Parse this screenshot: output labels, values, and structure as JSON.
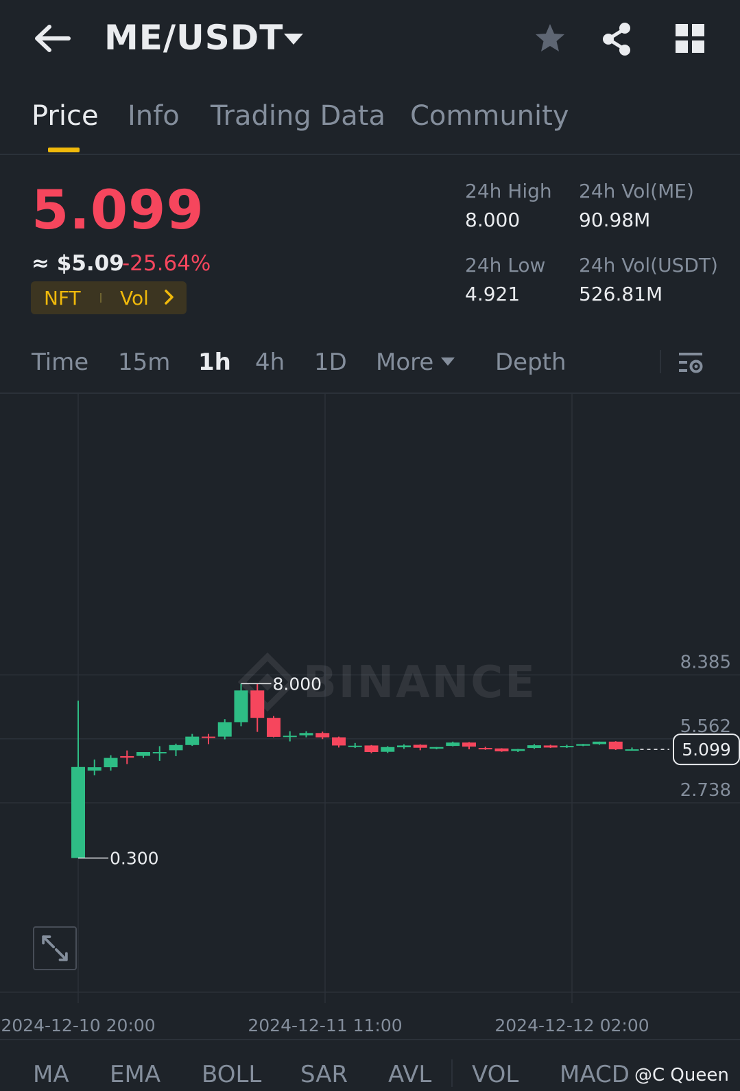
{
  "header": {
    "pair": "ME/USDT",
    "icons": [
      "back-arrow-icon",
      "caret-down-icon",
      "star-icon",
      "share-icon",
      "grid-icon"
    ]
  },
  "tabs": [
    {
      "label": "Price",
      "active": true
    },
    {
      "label": "Info",
      "active": false
    },
    {
      "label": "Trading Data",
      "active": false
    },
    {
      "label": "Community",
      "active": false
    }
  ],
  "price": {
    "last": "5.099",
    "usd": "≈ $5.09",
    "change": "-25.64%",
    "tag_nft": "NFT",
    "tag_vol": "Vol"
  },
  "stats": {
    "high_label": "24h High",
    "high_value": "8.000",
    "low_label": "24h Low",
    "low_value": "4.921",
    "vol_me_label": "24h Vol(ME)",
    "vol_me_value": "90.98M",
    "vol_usdt_label": "24h Vol(USDT)",
    "vol_usdt_value": "526.81M"
  },
  "intervals": {
    "time": "Time",
    "i15m": "15m",
    "i1h": "1h",
    "i4h": "4h",
    "i1d": "1D",
    "more": "More",
    "depth": "Depth",
    "active": "1h"
  },
  "chart_data": {
    "type": "candlestick",
    "watermark": "BINANCE",
    "y_ticks": [
      "8.385",
      "5.562",
      "2.738"
    ],
    "y_tick_values": [
      8.385,
      5.562,
      2.738
    ],
    "x_ticks": [
      "2024-12-10 20:00",
      "2024-12-11 11:00",
      "2024-12-12 02:00"
    ],
    "high_label": "8.000",
    "low_label": "0.300",
    "last_price_label": "5.099",
    "colors": {
      "up": "#2ebd85",
      "down": "#f6465d",
      "grid": "#2b3139",
      "axis_text": "#848e9c"
    },
    "candles": [
      {
        "o": 0.3,
        "h": 7.25,
        "l": 0.3,
        "c": 4.32
      },
      {
        "o": 4.16,
        "h": 4.65,
        "l": 3.95,
        "c": 4.31
      },
      {
        "o": 4.31,
        "h": 4.84,
        "l": 4.16,
        "c": 4.72
      },
      {
        "o": 4.8,
        "h": 5.05,
        "l": 4.45,
        "c": 4.73
      },
      {
        "o": 4.81,
        "h": 4.85,
        "l": 4.72,
        "c": 4.98
      },
      {
        "o": 4.92,
        "h": 5.24,
        "l": 4.59,
        "c": 4.98
      },
      {
        "o": 5.06,
        "h": 5.35,
        "l": 4.8,
        "c": 5.29
      },
      {
        "o": 5.29,
        "h": 5.78,
        "l": 5.25,
        "c": 5.66
      },
      {
        "o": 5.66,
        "h": 5.78,
        "l": 5.33,
        "c": 5.65
      },
      {
        "o": 5.66,
        "h": 6.43,
        "l": 5.54,
        "c": 6.3
      },
      {
        "o": 6.3,
        "h": 8.0,
        "l": 6.12,
        "c": 7.7
      },
      {
        "o": 7.7,
        "h": 8.0,
        "l": 5.87,
        "c": 6.49
      },
      {
        "o": 6.49,
        "h": 6.57,
        "l": 5.63,
        "c": 5.65
      },
      {
        "o": 5.65,
        "h": 5.9,
        "l": 5.45,
        "c": 5.7
      },
      {
        "o": 5.72,
        "h": 5.9,
        "l": 5.63,
        "c": 5.82
      },
      {
        "o": 5.82,
        "h": 5.88,
        "l": 5.55,
        "c": 5.63
      },
      {
        "o": 5.63,
        "h": 5.66,
        "l": 5.18,
        "c": 5.27
      },
      {
        "o": 5.24,
        "h": 5.38,
        "l": 5.16,
        "c": 5.26
      },
      {
        "o": 5.27,
        "h": 5.29,
        "l": 4.93,
        "c": 4.98
      },
      {
        "o": 4.99,
        "h": 5.24,
        "l": 4.94,
        "c": 5.2
      },
      {
        "o": 5.19,
        "h": 5.32,
        "l": 5.12,
        "c": 5.27
      },
      {
        "o": 5.3,
        "h": 5.32,
        "l": 5.06,
        "c": 5.17
      },
      {
        "o": 5.13,
        "h": 5.2,
        "l": 5.1,
        "c": 5.2
      },
      {
        "o": 5.25,
        "h": 5.44,
        "l": 5.23,
        "c": 5.4
      },
      {
        "o": 5.4,
        "h": 5.42,
        "l": 5.1,
        "c": 5.22
      },
      {
        "o": 5.16,
        "h": 5.21,
        "l": 5.08,
        "c": 5.14
      },
      {
        "o": 5.14,
        "h": 5.15,
        "l": 4.99,
        "c": 5.01
      },
      {
        "o": 5.03,
        "h": 5.12,
        "l": 4.98,
        "c": 5.11
      },
      {
        "o": 5.16,
        "h": 5.33,
        "l": 5.12,
        "c": 5.28
      },
      {
        "o": 5.27,
        "h": 5.3,
        "l": 5.16,
        "c": 5.18
      },
      {
        "o": 5.19,
        "h": 5.3,
        "l": 5.16,
        "c": 5.25
      },
      {
        "o": 5.26,
        "h": 5.34,
        "l": 5.24,
        "c": 5.33
      },
      {
        "o": 5.33,
        "h": 5.44,
        "l": 5.3,
        "c": 5.44
      },
      {
        "o": 5.44,
        "h": 5.46,
        "l": 5.07,
        "c": 5.1
      },
      {
        "o": 5.1,
        "h": 5.18,
        "l": 5.09,
        "c": 5.1
      }
    ]
  },
  "indicators": [
    "MA",
    "EMA",
    "BOLL",
    "SAR",
    "AVL",
    "VOL",
    "MACD"
  ],
  "credit": "@C Queen"
}
